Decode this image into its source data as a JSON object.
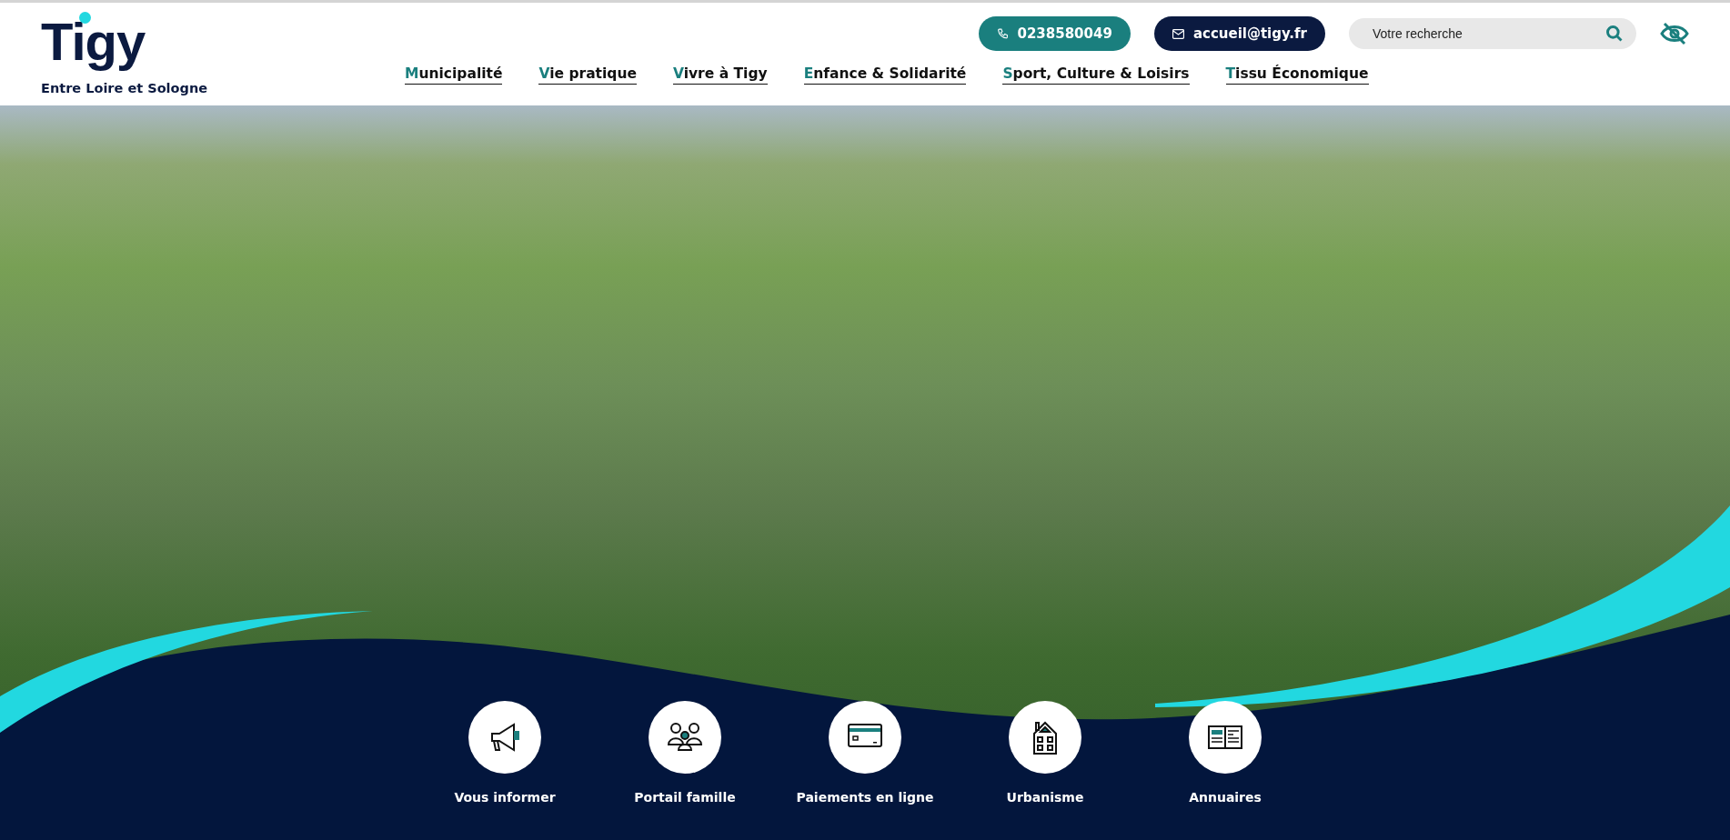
{
  "logo": {
    "name": "Tigy",
    "tagline": "Entre Loire et Sologne"
  },
  "contact": {
    "phone": "0238580049",
    "email": "accueil@tigy.fr"
  },
  "search": {
    "placeholder": "Votre recherche"
  },
  "nav": [
    "Municipalité",
    "Vie pratique",
    "Vivre à Tigy",
    "Enfance & Solidarité",
    "Sport, Culture & Loisirs",
    "Tissu Économique"
  ],
  "quick_links": [
    {
      "kind": "megaphone",
      "label": "Vous informer"
    },
    {
      "kind": "family",
      "label": "Portail famille"
    },
    {
      "kind": "card",
      "label": "Paiements en ligne"
    },
    {
      "kind": "house",
      "label": "Urbanisme"
    },
    {
      "kind": "book",
      "label": "Annuaires"
    }
  ]
}
